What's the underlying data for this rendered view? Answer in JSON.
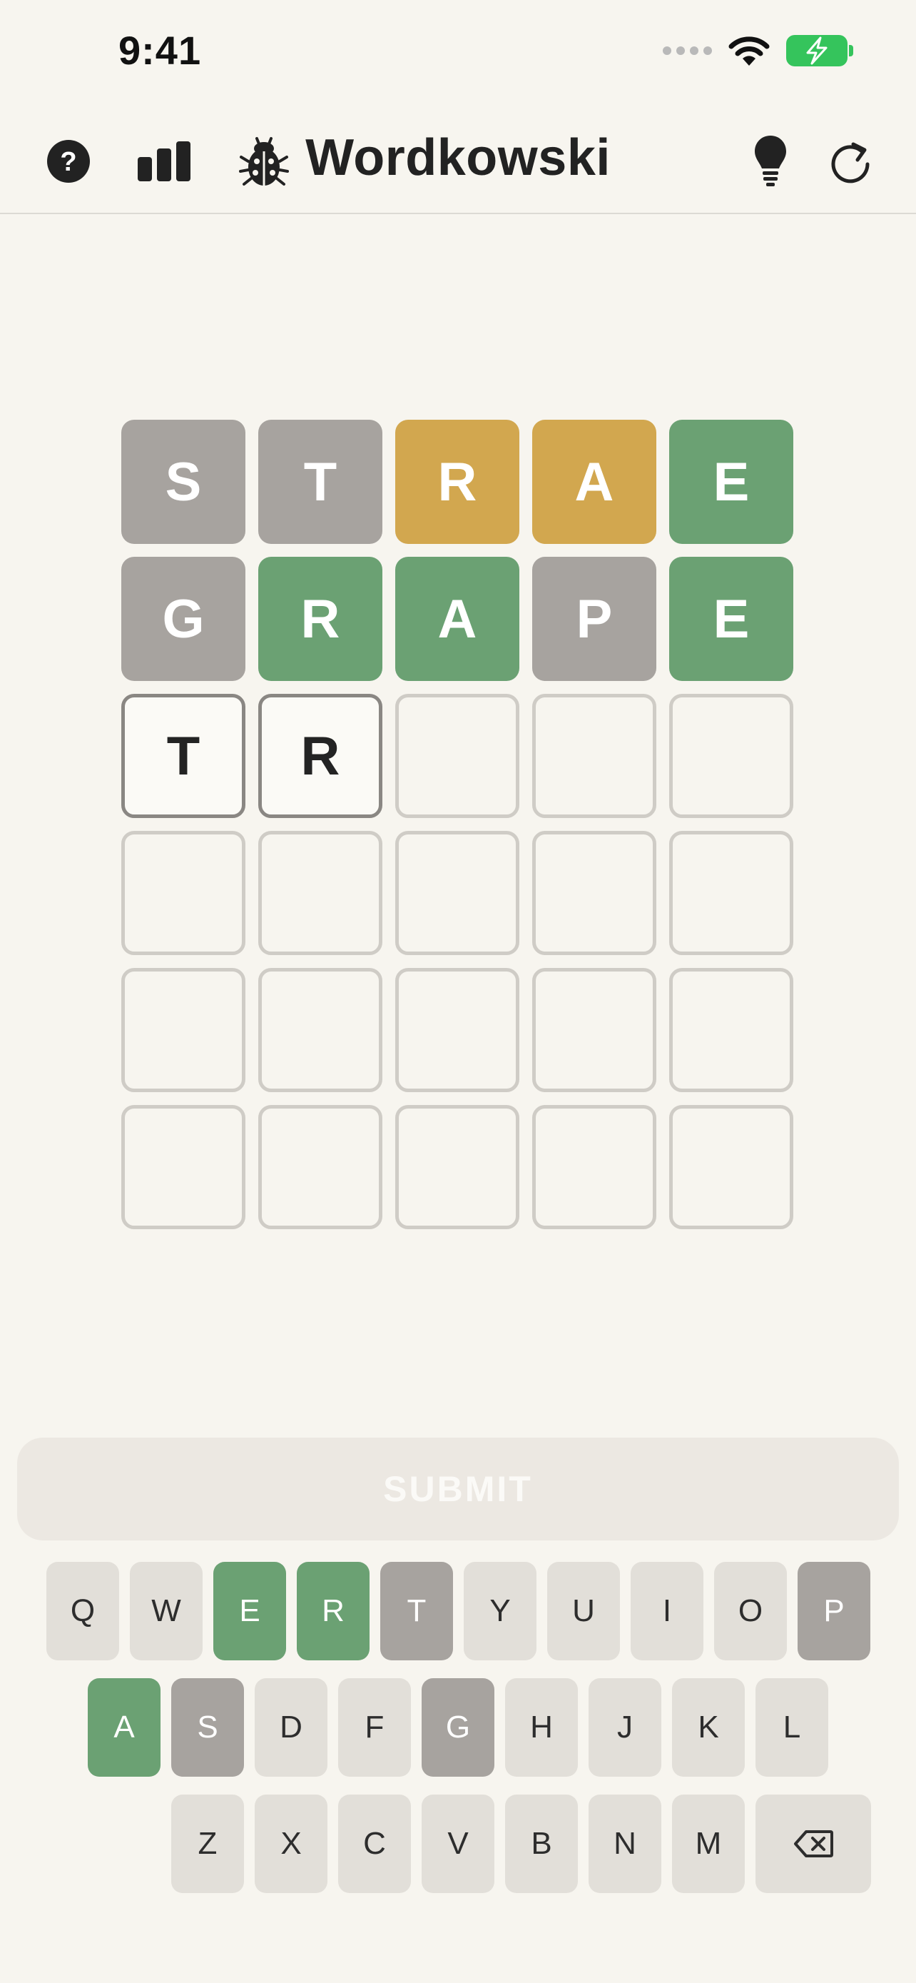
{
  "status_bar": {
    "time": "9:41"
  },
  "header": {
    "title": "Wordkowski",
    "left_icons": [
      "help-icon",
      "stats-icon",
      "bug-icon"
    ],
    "right_icons": [
      "hint-icon",
      "restart-icon"
    ]
  },
  "board": {
    "rows": [
      [
        {
          "letter": "S",
          "state": "absent"
        },
        {
          "letter": "T",
          "state": "absent"
        },
        {
          "letter": "R",
          "state": "present"
        },
        {
          "letter": "A",
          "state": "present"
        },
        {
          "letter": "E",
          "state": "correct"
        }
      ],
      [
        {
          "letter": "G",
          "state": "absent"
        },
        {
          "letter": "R",
          "state": "correct"
        },
        {
          "letter": "A",
          "state": "correct"
        },
        {
          "letter": "P",
          "state": "absent"
        },
        {
          "letter": "E",
          "state": "correct"
        }
      ],
      [
        {
          "letter": "T",
          "state": "filled"
        },
        {
          "letter": "R",
          "state": "filled"
        },
        {
          "letter": "",
          "state": "empty"
        },
        {
          "letter": "",
          "state": "empty"
        },
        {
          "letter": "",
          "state": "empty"
        }
      ],
      [
        {
          "letter": "",
          "state": "empty"
        },
        {
          "letter": "",
          "state": "empty"
        },
        {
          "letter": "",
          "state": "empty"
        },
        {
          "letter": "",
          "state": "empty"
        },
        {
          "letter": "",
          "state": "empty"
        }
      ],
      [
        {
          "letter": "",
          "state": "empty"
        },
        {
          "letter": "",
          "state": "empty"
        },
        {
          "letter": "",
          "state": "empty"
        },
        {
          "letter": "",
          "state": "empty"
        },
        {
          "letter": "",
          "state": "empty"
        }
      ],
      [
        {
          "letter": "",
          "state": "empty"
        },
        {
          "letter": "",
          "state": "empty"
        },
        {
          "letter": "",
          "state": "empty"
        },
        {
          "letter": "",
          "state": "empty"
        },
        {
          "letter": "",
          "state": "empty"
        }
      ]
    ]
  },
  "submit_label": "SUBMIT",
  "keyboard": {
    "rows": [
      [
        {
          "key": "Q",
          "state": "unused"
        },
        {
          "key": "W",
          "state": "unused"
        },
        {
          "key": "E",
          "state": "correct"
        },
        {
          "key": "R",
          "state": "correct"
        },
        {
          "key": "T",
          "state": "absent"
        },
        {
          "key": "Y",
          "state": "unused"
        },
        {
          "key": "U",
          "state": "unused"
        },
        {
          "key": "I",
          "state": "unused"
        },
        {
          "key": "O",
          "state": "unused"
        },
        {
          "key": "P",
          "state": "absent"
        }
      ],
      [
        {
          "key": "A",
          "state": "correct"
        },
        {
          "key": "S",
          "state": "absent"
        },
        {
          "key": "D",
          "state": "unused"
        },
        {
          "key": "F",
          "state": "unused"
        },
        {
          "key": "G",
          "state": "absent"
        },
        {
          "key": "H",
          "state": "unused"
        },
        {
          "key": "J",
          "state": "unused"
        },
        {
          "key": "K",
          "state": "unused"
        },
        {
          "key": "L",
          "state": "unused"
        }
      ],
      [
        {
          "key": "Z",
          "state": "unused"
        },
        {
          "key": "X",
          "state": "unused"
        },
        {
          "key": "C",
          "state": "unused"
        },
        {
          "key": "V",
          "state": "unused"
        },
        {
          "key": "B",
          "state": "unused"
        },
        {
          "key": "N",
          "state": "unused"
        },
        {
          "key": "M",
          "state": "unused"
        }
      ]
    ],
    "backspace_icon": "backspace-icon"
  },
  "colors": {
    "background": "#f7f5ef",
    "correct": "#6ba173",
    "present": "#d2a74f",
    "absent": "#a7a39f",
    "key_unused": "#e2dfd9",
    "battery": "#35c45c"
  }
}
